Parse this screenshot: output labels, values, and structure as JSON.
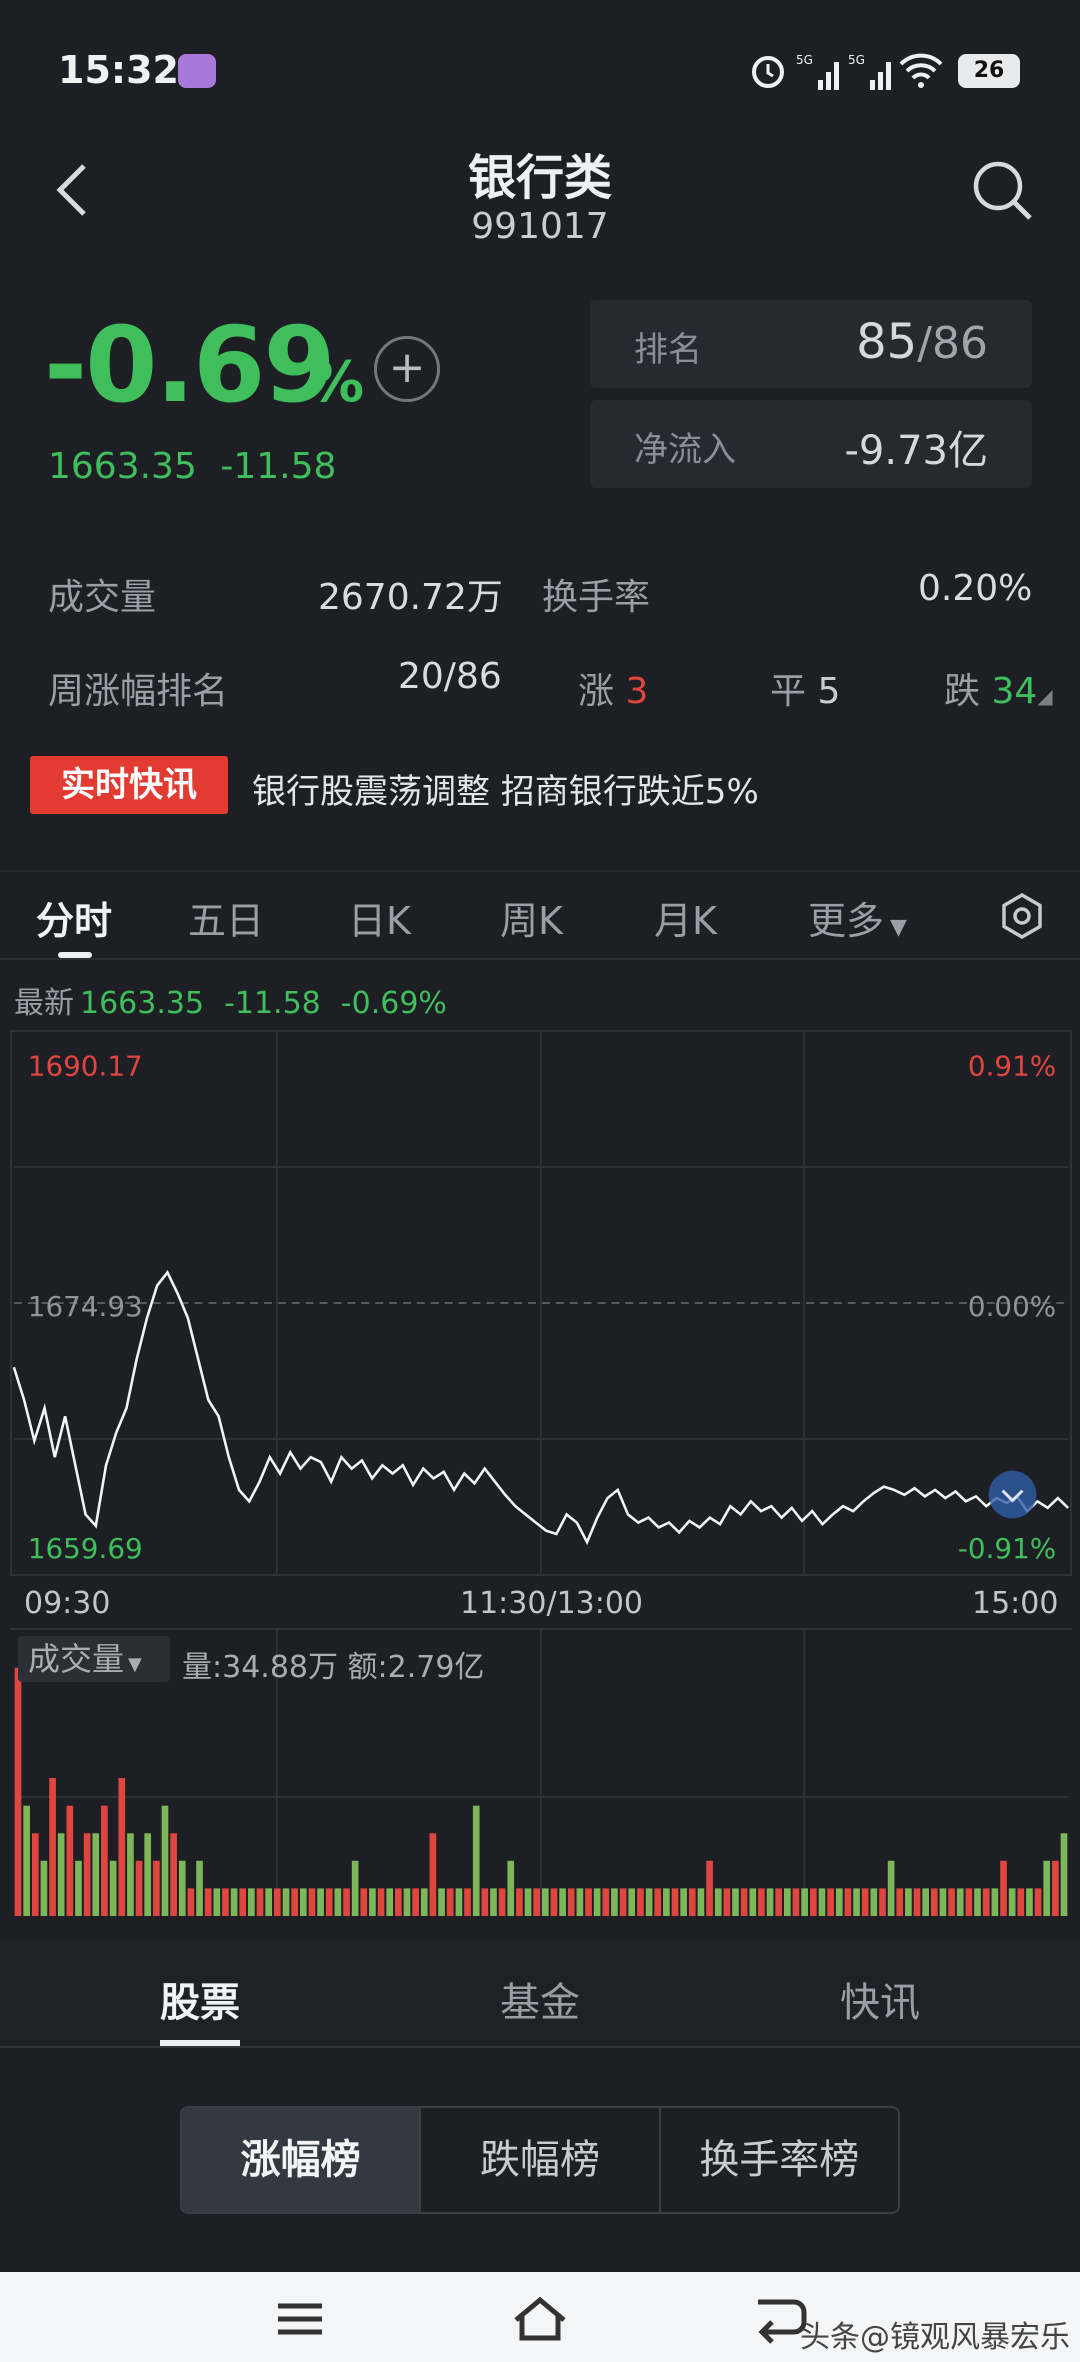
{
  "status_bar": {
    "time": "15:32",
    "battery": "26"
  },
  "header": {
    "title": "银行类",
    "code": "991017"
  },
  "quote": {
    "change_pct": "-0.69",
    "pct_unit": "%",
    "price": "1663.35",
    "change": "-11.58",
    "rank_label": "排名",
    "rank_value": "85",
    "rank_total": "/86",
    "netflow_label": "净流入",
    "netflow_value": "-9.73亿"
  },
  "stats": {
    "volume_label": "成交量",
    "volume_value": "2670.72万",
    "turnover_label": "换手率",
    "turnover_value": "0.20%",
    "week_rank_label": "周涨幅排名",
    "week_rank_value": "20/86",
    "up_label": "涨",
    "up_value": "3",
    "flat_label": "平",
    "flat_value": "5",
    "down_label": "跌",
    "down_value": "34"
  },
  "news": {
    "badge": "实时快讯",
    "headline": "银行股震荡调整 招商银行跌近5%"
  },
  "chart_tabs": [
    "分时",
    "五日",
    "日K",
    "周K",
    "月K",
    "更多"
  ],
  "latest": {
    "label": "最新",
    "price": "1663.35",
    "change": "-11.58",
    "pct": "-0.69%"
  },
  "colors": {
    "up": "#e0463f",
    "down": "#3fbf5b",
    "line": "#f2f3f5",
    "background": "#1d1f24"
  },
  "chart_data": {
    "type": "line",
    "y_left_ticks": [
      "1690.17",
      "1674.93",
      "1659.69"
    ],
    "y_right_ticks": [
      "0.91%",
      "0.00%",
      "-0.91%"
    ],
    "x_ticks": [
      "09:30",
      "11:30/13:00",
      "15:00"
    ],
    "ylim": [
      1659.69,
      1690.17
    ],
    "series": [
      {
        "values": [
          1671.0,
          1669.0,
          1666.5,
          1668.5,
          1665.5,
          1668.0,
          1665.0,
          1662.0,
          1661.3,
          1665.0,
          1667.0,
          1668.5,
          1671.5,
          1674.0,
          1676.0,
          1676.8,
          1675.5,
          1674.0,
          1671.5,
          1669.0,
          1668.0,
          1665.5,
          1663.5,
          1662.8,
          1664.0,
          1665.5,
          1664.5,
          1665.8,
          1664.8,
          1665.5,
          1665.2,
          1664.0,
          1665.5,
          1664.8,
          1665.3,
          1664.2,
          1665.0,
          1664.5,
          1665.0,
          1663.8,
          1664.8,
          1664.2,
          1664.6,
          1663.5,
          1664.5,
          1663.9,
          1664.8,
          1664.0,
          1663.2,
          1662.5,
          1662.0,
          1661.5,
          1661.0,
          1660.8,
          1662.0,
          1661.5,
          1660.3,
          1661.8,
          1663.0,
          1663.5,
          1662.0,
          1661.5,
          1661.8,
          1661.2,
          1661.5,
          1660.9,
          1661.6,
          1661.2,
          1661.8,
          1661.4,
          1662.5,
          1662.0,
          1662.8,
          1662.2,
          1662.5,
          1661.8,
          1662.4,
          1661.6,
          1662.2,
          1661.4,
          1662.0,
          1662.5,
          1662.2,
          1662.8,
          1663.3,
          1663.7,
          1663.5,
          1663.2,
          1663.6,
          1663.1,
          1663.5,
          1663.0,
          1663.4,
          1662.8,
          1663.1,
          1662.5,
          1663.0,
          1662.7,
          1663.1,
          1662.2,
          1662.8,
          1662.4,
          1663.0,
          1662.4
        ]
      }
    ],
    "volume": {
      "label": "成交量",
      "info": "量:34.88万 额:2.79亿",
      "bars": [
        9,
        4,
        3,
        2,
        5,
        3,
        4,
        2,
        3,
        3,
        4,
        2,
        5,
        3,
        2,
        3,
        2,
        4,
        3,
        2,
        1,
        2,
        1,
        1,
        1,
        1,
        1,
        1,
        1,
        1,
        1,
        1,
        1,
        1,
        1,
        1,
        1,
        1,
        1,
        2,
        1,
        1,
        1,
        1,
        1,
        1,
        1,
        1,
        3,
        1,
        1,
        1,
        1,
        4,
        1,
        1,
        1,
        2,
        1,
        1,
        1,
        1,
        1,
        1,
        1,
        1,
        1,
        1,
        1,
        1,
        1,
        1,
        1,
        1,
        1,
        1,
        1,
        1,
        1,
        1,
        2,
        1,
        1,
        1,
        1,
        1,
        1,
        1,
        1,
        1,
        1,
        1,
        1,
        1,
        1,
        1,
        1,
        1,
        1,
        1,
        1,
        2,
        1,
        1,
        1,
        1,
        1,
        1,
        1,
        1,
        1,
        1,
        1,
        1,
        2,
        1,
        1,
        1,
        1,
        2,
        2,
        3
      ],
      "colors": "gr"
    }
  },
  "bottom_tabs": [
    "股票",
    "基金",
    "快讯"
  ],
  "rank_segments": [
    "涨幅榜",
    "跌幅榜",
    "换手率榜"
  ],
  "watermark": "头条@镜观风暴宏乐"
}
